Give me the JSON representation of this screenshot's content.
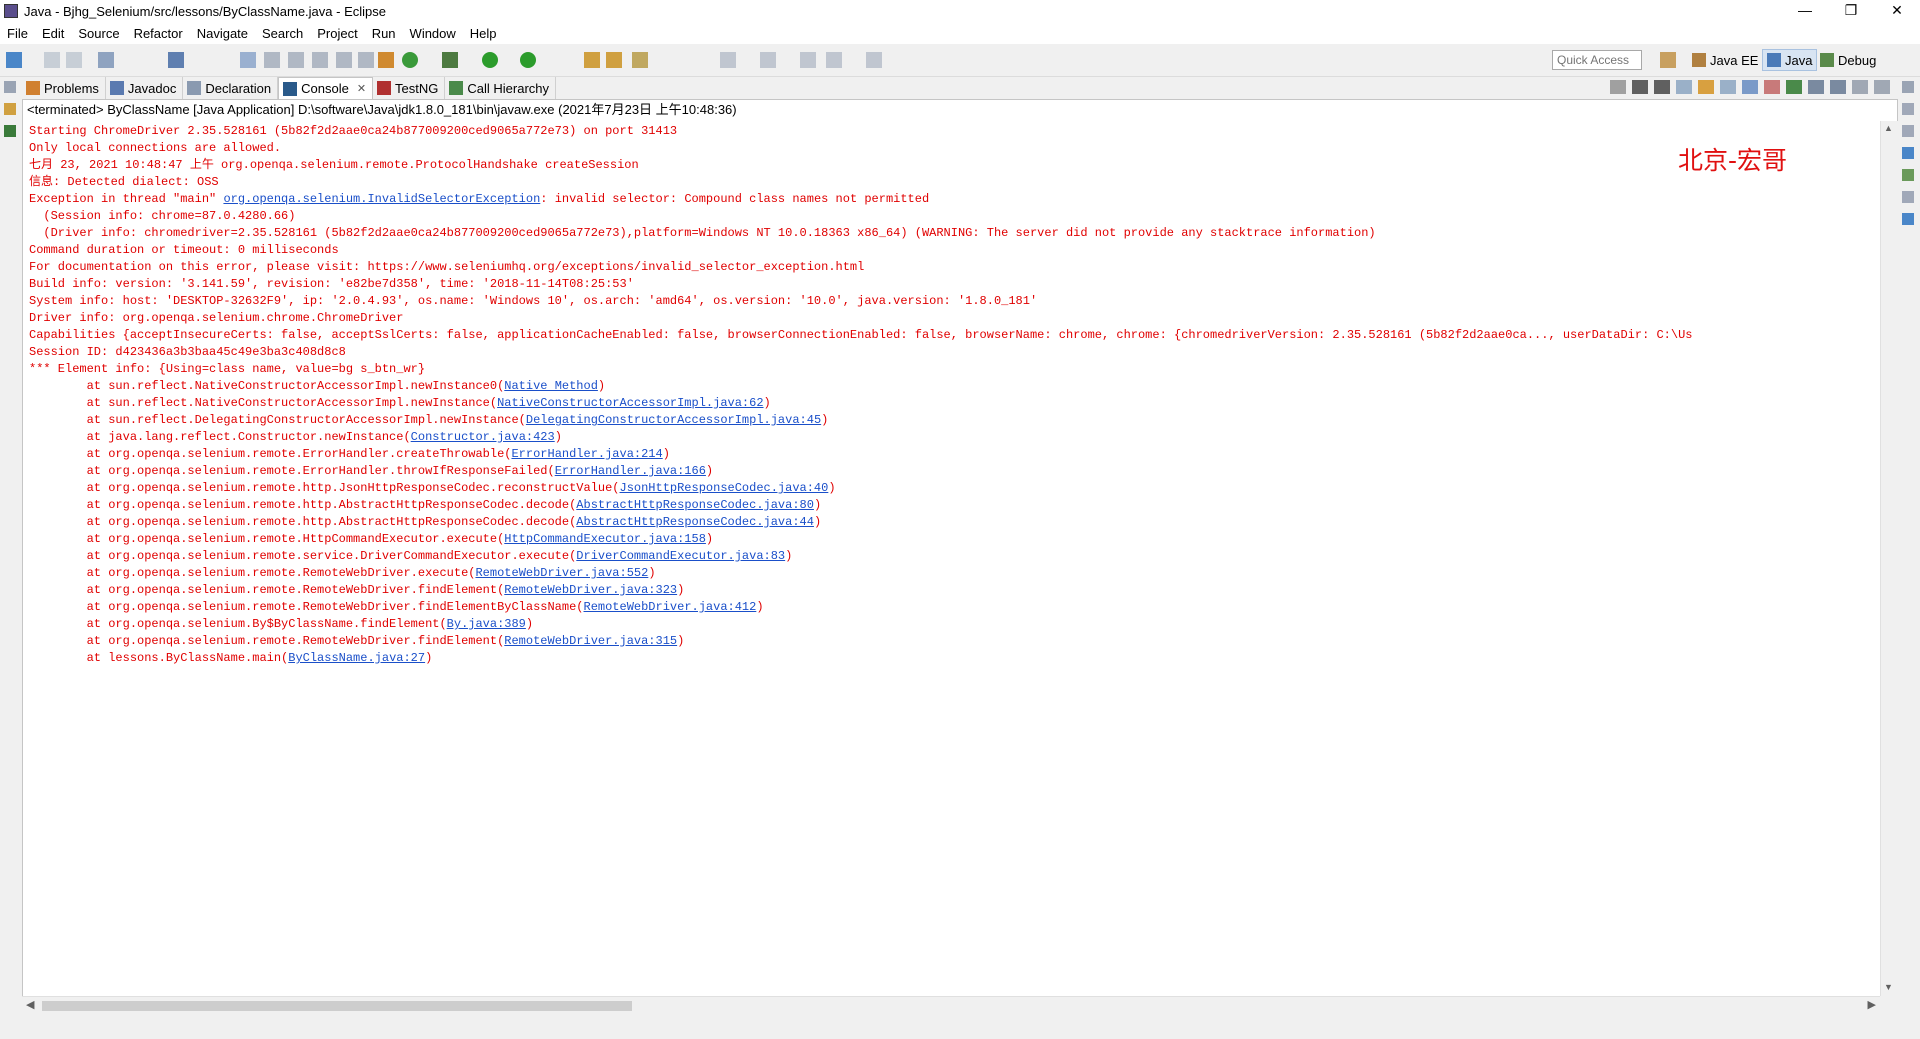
{
  "window": {
    "title": "Java - Bjhg_Selenium/src/lessons/ByClassName.java - Eclipse"
  },
  "menu": [
    "File",
    "Edit",
    "Source",
    "Refactor",
    "Navigate",
    "Search",
    "Project",
    "Run",
    "Window",
    "Help"
  ],
  "toolbar": {
    "quick_access_placeholder": "Quick Access",
    "perspectives": {
      "java_ee": "Java EE",
      "java": "Java",
      "debug": "Debug"
    }
  },
  "tabs": [
    "Problems",
    "Javadoc",
    "Declaration",
    "Console",
    "TestNG",
    "Call Hierarchy"
  ],
  "console": {
    "header": "<terminated> ByClassName [Java Application] D:\\software\\Java\\jdk1.8.0_181\\bin\\javaw.exe (2021年7月23日 上午10:48:36)",
    "line0": "Starting ChromeDriver 2.35.528161 (5b82f2d2aae0ca24b877009200ced9065a772e73) on port 31413",
    "line1": "Only local connections are allowed.",
    "line2": "七月 23, 2021 10:48:47 上午 org.openqa.selenium.remote.ProtocolHandshake createSession",
    "line3": "信息: Detected dialect: OSS",
    "line4_pre": "Exception in thread \"main\" ",
    "line4_link": "org.openqa.selenium.InvalidSelectorException",
    "line4_post": ": invalid selector: Compound class names not permitted",
    "line5": "  (Session info: chrome=87.0.4280.66)",
    "line6": "  (Driver info: chromedriver=2.35.528161 (5b82f2d2aae0ca24b877009200ced9065a772e73),platform=Windows NT 10.0.18363 x86_64) (WARNING: The server did not provide any stacktrace information)",
    "line7": "Command duration or timeout: 0 milliseconds",
    "line8": "For documentation on this error, please visit: https://www.seleniumhq.org/exceptions/invalid_selector_exception.html",
    "line9": "Build info: version: '3.141.59', revision: 'e82be7d358', time: '2018-11-14T08:25:53'",
    "line10": "System info: host: 'DESKTOP-32632F9', ip: '2.0.4.93', os.name: 'Windows 10', os.arch: 'amd64', os.version: '10.0', java.version: '1.8.0_181'",
    "line11": "Driver info: org.openqa.selenium.chrome.ChromeDriver",
    "line12": "Capabilities {acceptInsecureCerts: false, acceptSslCerts: false, applicationCacheEnabled: false, browserConnectionEnabled: false, browserName: chrome, chrome: {chromedriverVersion: 2.35.528161 (5b82f2d2aae0ca..., userDataDir: C:\\Us",
    "line13": "Session ID: d423436a3b3baa45c49e3ba3c408d8c8",
    "line14": "*** Element info: {Using=class name, value=bg s_btn_wr}",
    "stack": [
      {
        "at": "        at sun.reflect.NativeConstructorAccessorImpl.newInstance0(",
        "link": "Native Method",
        "end": ")"
      },
      {
        "at": "        at sun.reflect.NativeConstructorAccessorImpl.newInstance(",
        "link": "NativeConstructorAccessorImpl.java:62",
        "end": ")"
      },
      {
        "at": "        at sun.reflect.DelegatingConstructorAccessorImpl.newInstance(",
        "link": "DelegatingConstructorAccessorImpl.java:45",
        "end": ")"
      },
      {
        "at": "        at java.lang.reflect.Constructor.newInstance(",
        "link": "Constructor.java:423",
        "end": ")"
      },
      {
        "at": "        at org.openqa.selenium.remote.ErrorHandler.createThrowable(",
        "link": "ErrorHandler.java:214",
        "end": ")"
      },
      {
        "at": "        at org.openqa.selenium.remote.ErrorHandler.throwIfResponseFailed(",
        "link": "ErrorHandler.java:166",
        "end": ")"
      },
      {
        "at": "        at org.openqa.selenium.remote.http.JsonHttpResponseCodec.reconstructValue(",
        "link": "JsonHttpResponseCodec.java:40",
        "end": ")"
      },
      {
        "at": "        at org.openqa.selenium.remote.http.AbstractHttpResponseCodec.decode(",
        "link": "AbstractHttpResponseCodec.java:80",
        "end": ")"
      },
      {
        "at": "        at org.openqa.selenium.remote.http.AbstractHttpResponseCodec.decode(",
        "link": "AbstractHttpResponseCodec.java:44",
        "end": ")"
      },
      {
        "at": "        at org.openqa.selenium.remote.HttpCommandExecutor.execute(",
        "link": "HttpCommandExecutor.java:158",
        "end": ")"
      },
      {
        "at": "        at org.openqa.selenium.remote.service.DriverCommandExecutor.execute(",
        "link": "DriverCommandExecutor.java:83",
        "end": ")"
      },
      {
        "at": "        at org.openqa.selenium.remote.RemoteWebDriver.execute(",
        "link": "RemoteWebDriver.java:552",
        "end": ")"
      },
      {
        "at": "        at org.openqa.selenium.remote.RemoteWebDriver.findElement(",
        "link": "RemoteWebDriver.java:323",
        "end": ")"
      },
      {
        "at": "        at org.openqa.selenium.remote.RemoteWebDriver.findElementByClassName(",
        "link": "RemoteWebDriver.java:412",
        "end": ")"
      },
      {
        "at": "        at org.openqa.selenium.By$ByClassName.findElement(",
        "link": "By.java:389",
        "end": ")"
      },
      {
        "at": "        at org.openqa.selenium.remote.RemoteWebDriver.findElement(",
        "link": "RemoteWebDriver.java:315",
        "end": ")"
      },
      {
        "at": "        at lessons.ByClassName.main(",
        "link": "ByClassName.java:27",
        "end": ")"
      }
    ]
  },
  "watermark": "北京-宏哥",
  "colors": {
    "error_text": "#e00000",
    "link": "#1a4fc9"
  }
}
